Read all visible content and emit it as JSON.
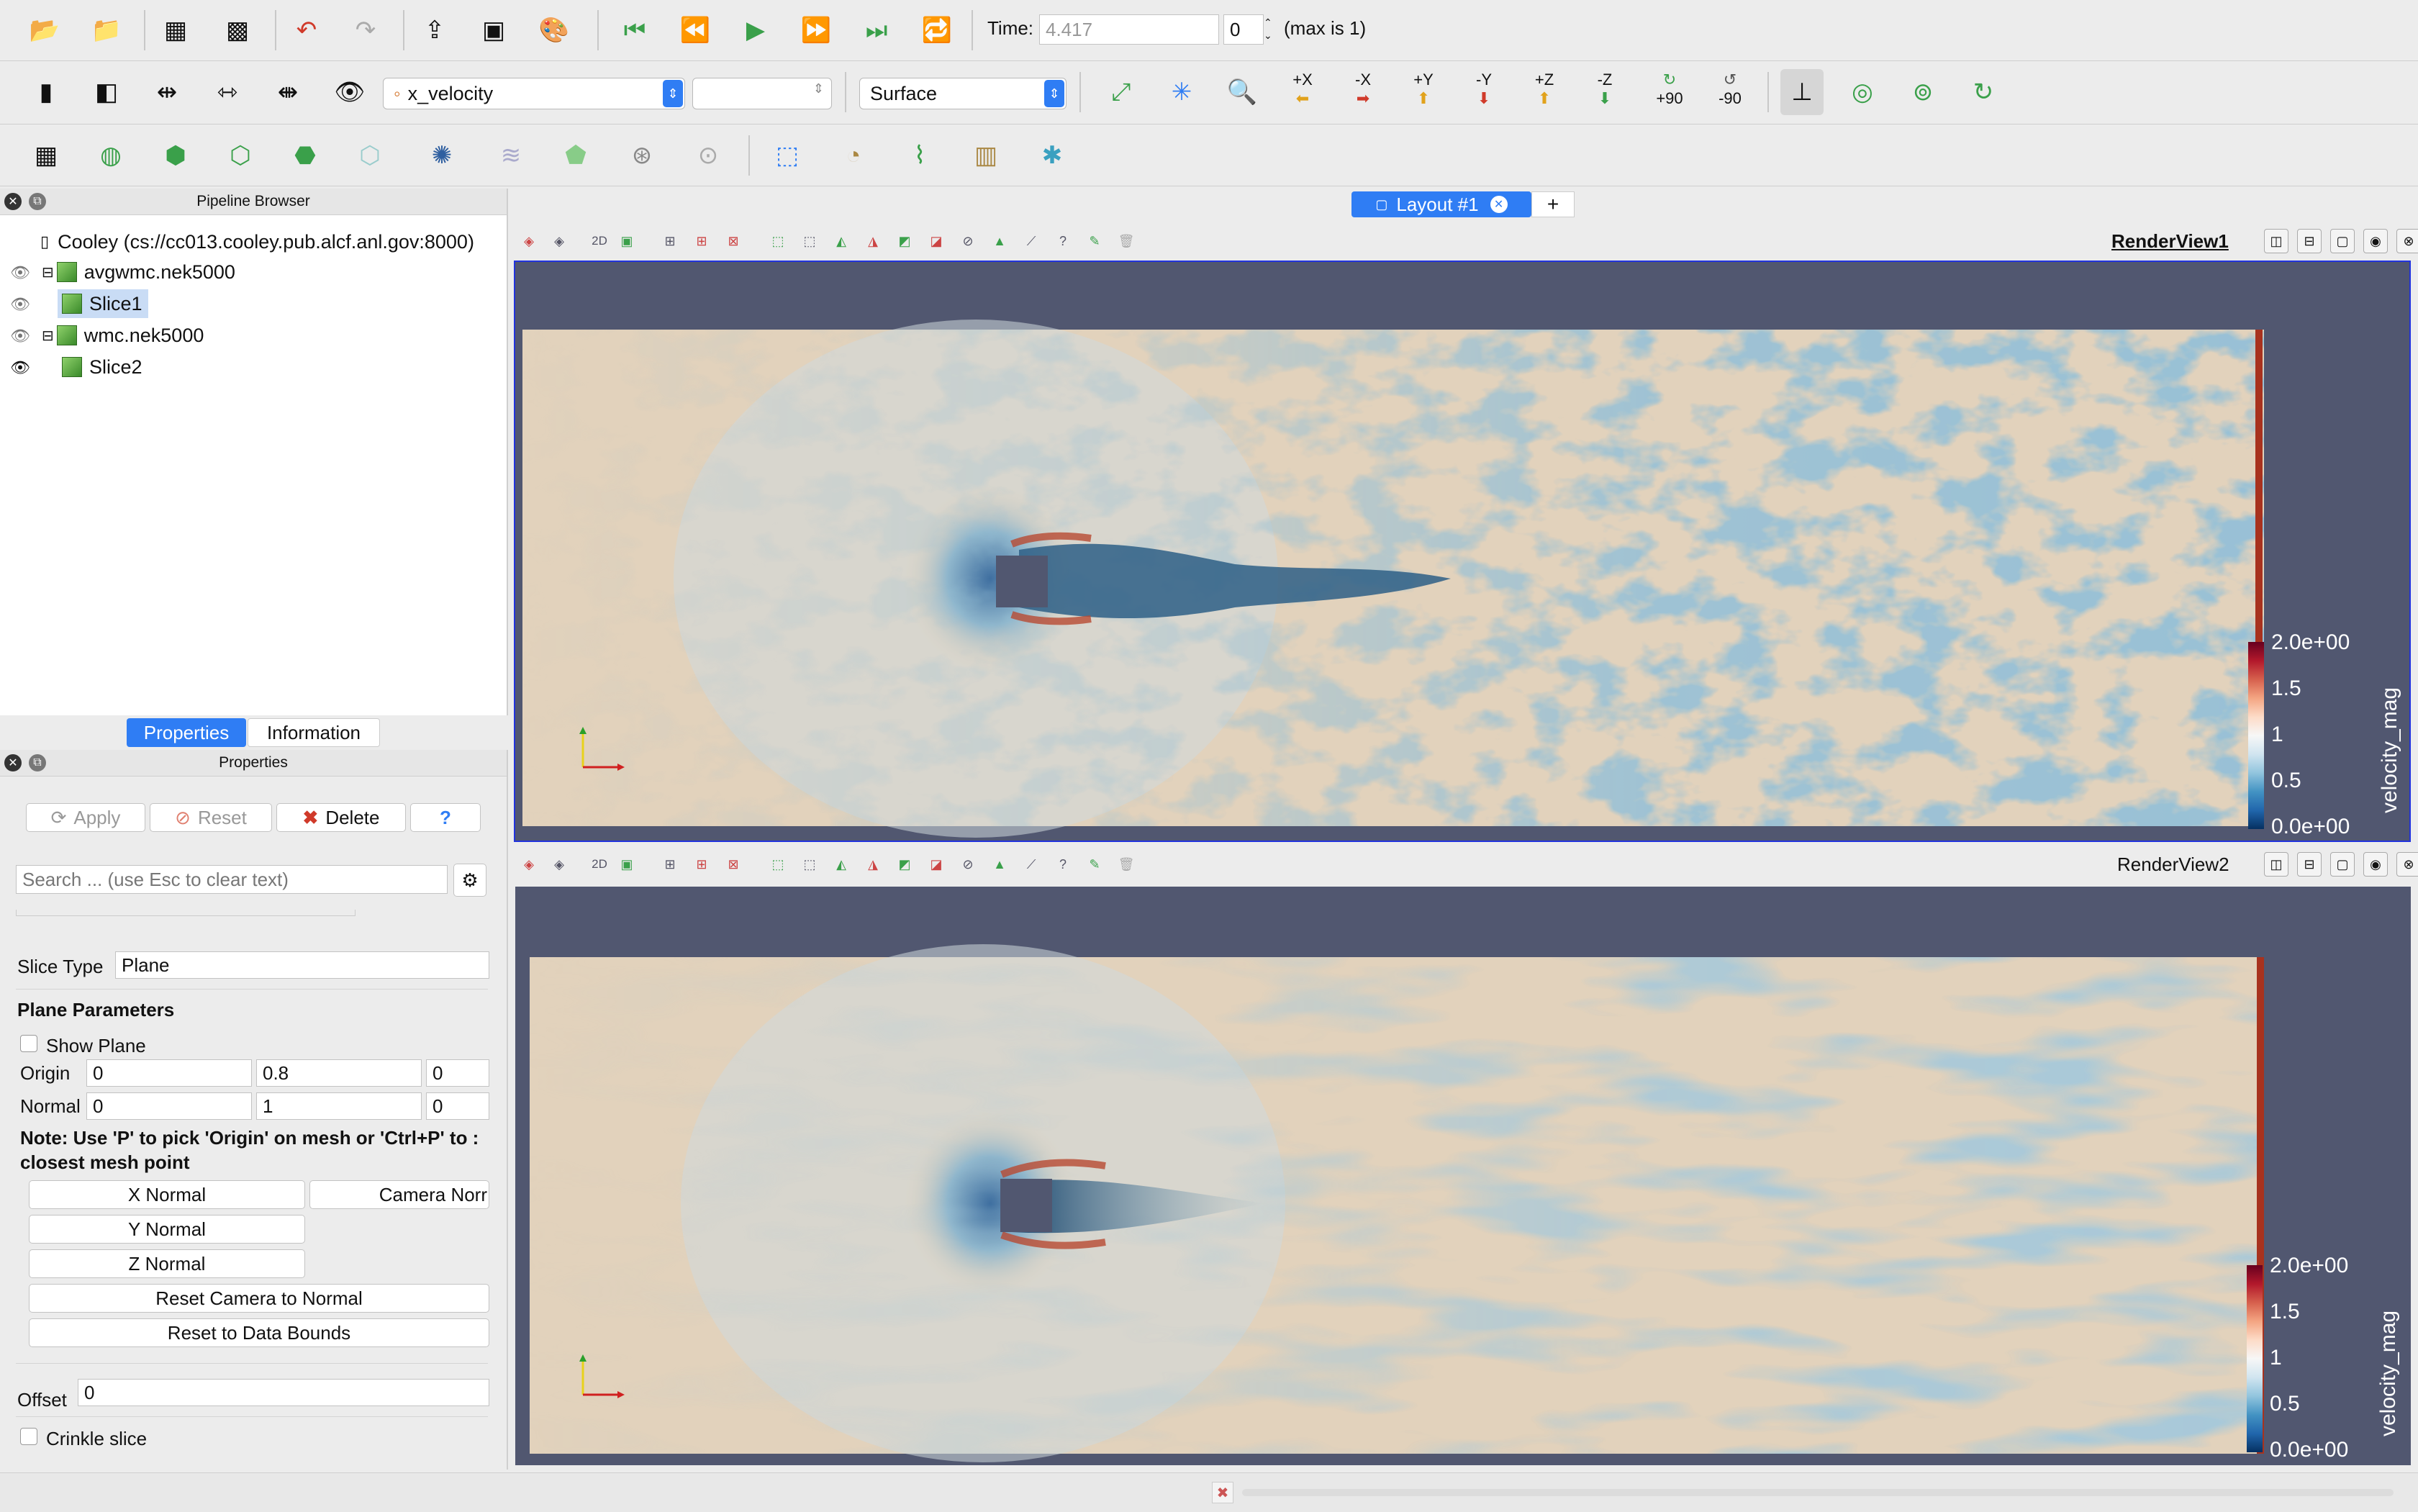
{
  "top_toolbar": {
    "time_label": "Time:",
    "time_value": "4.417",
    "time_index": "0",
    "time_max": "(max is 1)"
  },
  "second_toolbar": {
    "array_combo": "x_velocity",
    "component_combo": "",
    "representation_combo": "Surface",
    "view_buttons": [
      "+X",
      "-X",
      "+Y",
      "-Y",
      "+Z",
      "-Z",
      "+90",
      "-90"
    ]
  },
  "pipeline": {
    "title": "Pipeline Browser",
    "server": "Cooley (cs://cc013.cooley.pub.alcf.anl.gov:8000)",
    "items": [
      {
        "label": "avgwmc.nek5000"
      },
      {
        "label": "Slice1"
      },
      {
        "label": "wmc.nek5000"
      },
      {
        "label": "Slice2"
      }
    ]
  },
  "tabs": {
    "properties": "Properties",
    "information": "Information"
  },
  "properties": {
    "title": "Properties",
    "apply": "Apply",
    "reset": "Reset",
    "delete": "Delete",
    "help": "?",
    "search_placeholder": "Search ... (use Esc to clear text)",
    "slice_type_label": "Slice Type",
    "slice_type_value": "Plane",
    "plane_params_label": "Plane Parameters",
    "show_plane": "Show Plane",
    "origin_label": "Origin",
    "origin": [
      "0",
      "0.8",
      "0"
    ],
    "normal_label": "Normal",
    "normal": [
      "0",
      "1",
      "0"
    ],
    "note": "Note: Use 'P' to pick 'Origin' on mesh or 'Ctrl+P' to snap to the closest mesh point",
    "note_line1": "Note: Use 'P' to pick 'Origin' on mesh or 'Ctrl+P' to :",
    "note_line2": "closest mesh point",
    "x_normal": "X Normal",
    "camera_normal": "Camera Norr",
    "y_normal": "Y Normal",
    "z_normal": "Z Normal",
    "reset_camera": "Reset Camera to Normal",
    "reset_bounds": "Reset to Data Bounds",
    "offset_label": "Offset",
    "offset_value": "0",
    "crinkle": "Crinkle slice"
  },
  "layout_tab": {
    "label": "Layout #1",
    "add": "+"
  },
  "render_view1": {
    "name": "RenderView1",
    "toolbar_2d": "2D",
    "colorbar": {
      "title": "velocity_mag",
      "ticks": [
        "2.0e+00",
        "1.5",
        "1",
        "0.5",
        "0.0e+00"
      ]
    }
  },
  "render_view2": {
    "name": "RenderView2",
    "toolbar_2d": "2D",
    "colorbar": {
      "title": "velocity_mag",
      "ticks": [
        "2.0e+00",
        "1.5",
        "1",
        "0.5",
        "0.0e+00"
      ]
    }
  },
  "colors": {
    "view_bg": "#515770",
    "field_beige": "#e2d2bc",
    "field_blue": "#4f86a8",
    "field_red": "#b84a32",
    "accent_blue": "#2f7df4"
  }
}
